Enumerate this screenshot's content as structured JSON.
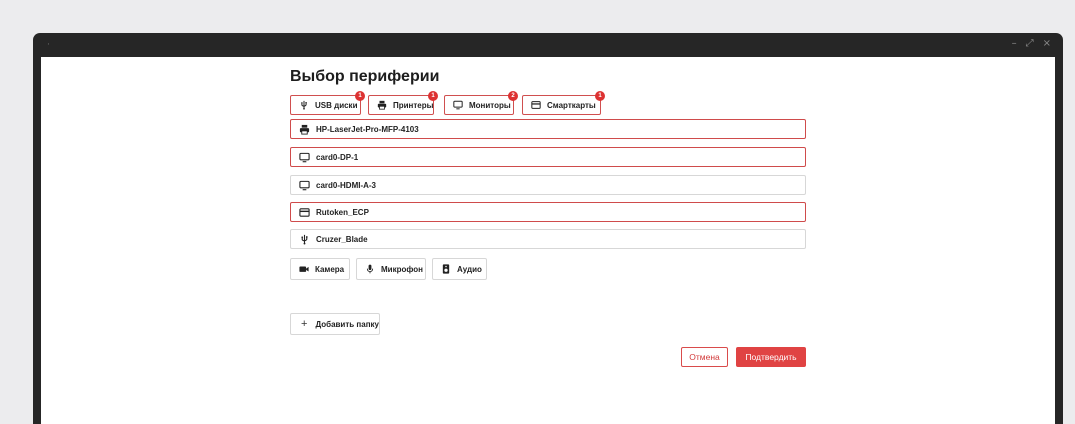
{
  "window": {
    "title_dot": "·",
    "controls": {
      "minimize": "–",
      "maximize": "⤢",
      "close": "×"
    }
  },
  "page": {
    "title": "Выбор периферии"
  },
  "tabs": [
    {
      "label": "USB диски",
      "badge": "1",
      "icon": "usb-icon"
    },
    {
      "label": "Принтеры",
      "badge": "1",
      "icon": "printer-icon"
    },
    {
      "label": "Мониторы",
      "badge": "2",
      "icon": "monitor-icon"
    },
    {
      "label": "Смарткарты",
      "badge": "1",
      "icon": "smartcard-icon"
    }
  ],
  "devices": [
    {
      "name": "HP-LaserJet-Pro-MFP-4103",
      "icon": "printer-icon",
      "selected": true
    },
    {
      "name": "card0-DP-1",
      "icon": "monitor-icon",
      "selected": true
    },
    {
      "name": "card0-HDMI-A-3",
      "icon": "monitor-icon",
      "selected": false
    },
    {
      "name": "Rutoken_ECP",
      "icon": "smartcard-icon",
      "selected": true
    },
    {
      "name": "Cruzer_Blade",
      "icon": "usb-icon",
      "selected": false
    }
  ],
  "media": [
    {
      "label": "Камера",
      "icon": "camera-icon"
    },
    {
      "label": "Микрофон",
      "icon": "microphone-icon"
    },
    {
      "label": "Аудио",
      "icon": "speaker-icon"
    }
  ],
  "add_folder": {
    "plus": "+",
    "label": "Добавить папку"
  },
  "actions": {
    "cancel": "Отмена",
    "confirm": "Подтвердить"
  },
  "colors": {
    "accent": "#e04343",
    "selected_border": "#cf4b4b",
    "badge": "#dd3232"
  }
}
